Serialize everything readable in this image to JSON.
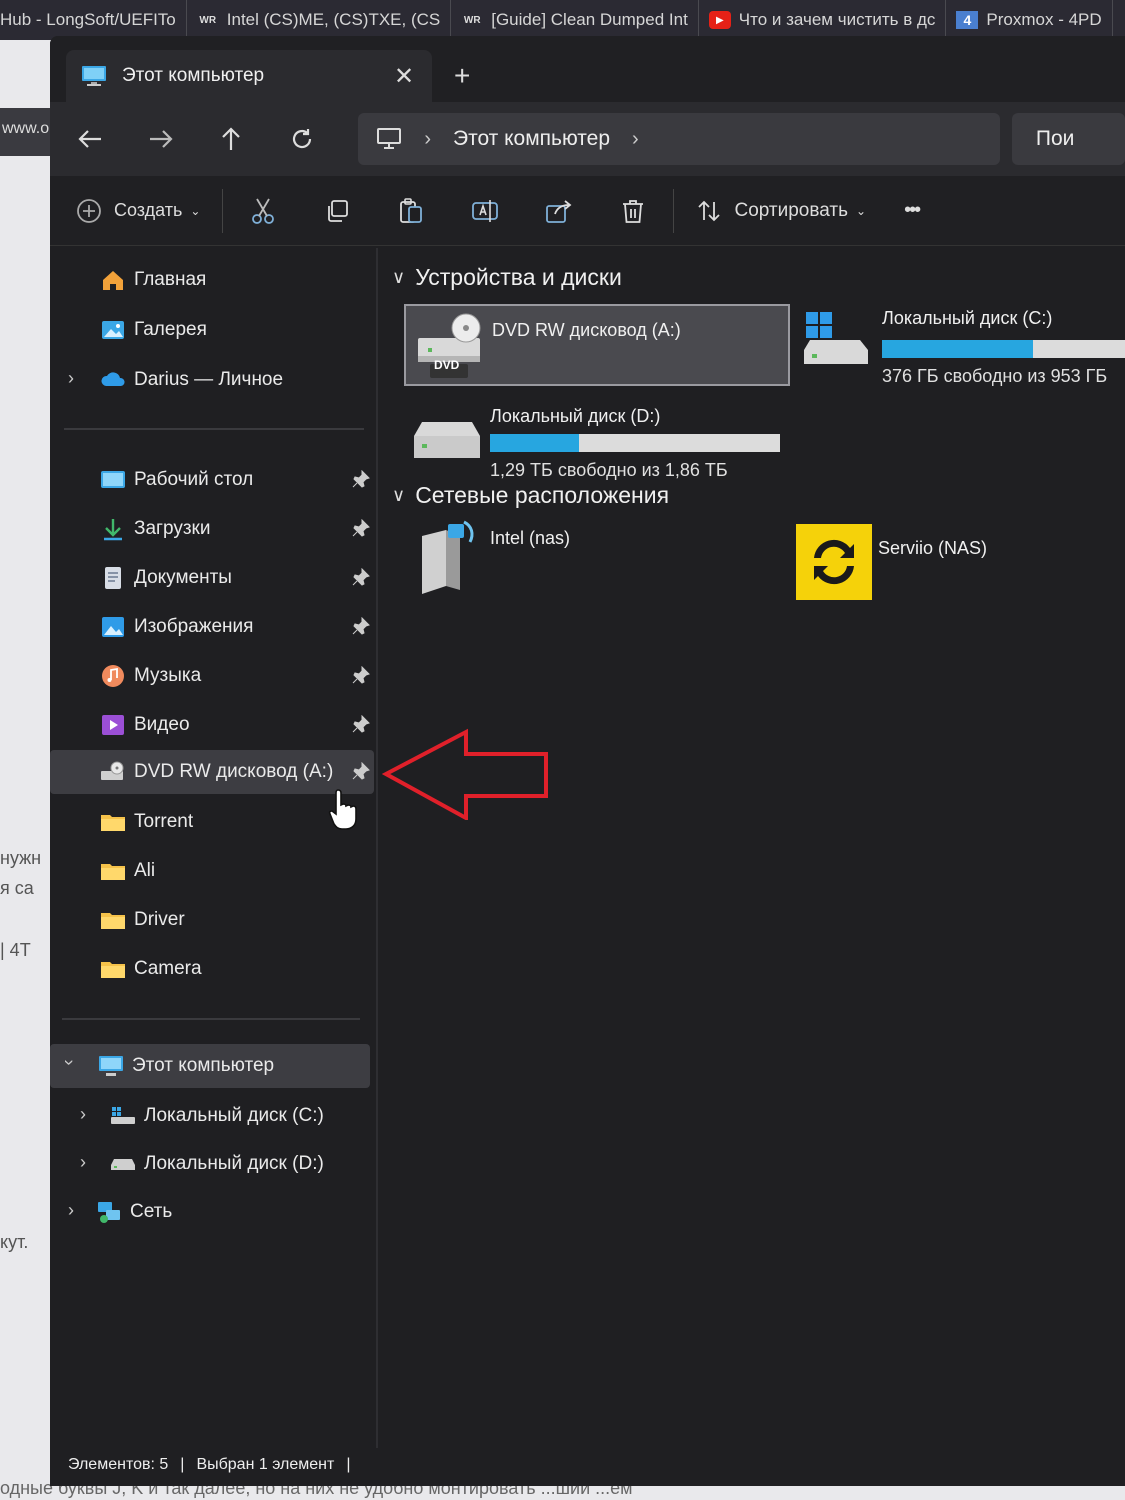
{
  "browser_tabs": [
    {
      "label": "Hub - LongSoft/UEFITo",
      "icon": "github-icon"
    },
    {
      "label": "Intel (CS)ME, (CS)TXE, (CS",
      "icon": "wr-icon",
      "fav": "WR"
    },
    {
      "label": "[Guide] Clean Dumped Int",
      "icon": "wr-icon",
      "fav": "WR"
    },
    {
      "label": "Что и зачем чистить в дс",
      "icon": "youtube-icon"
    },
    {
      "label": "Proxmox - 4PD",
      "icon": "proxmox-icon"
    }
  ],
  "bg_page": {
    "url_fragment": "www.o",
    "text_lines": [
      "нужн",
      "я са",
      "| 4Т",
      "кут."
    ],
    "bottom_text": "одные буквы J, K и так далее, но на них не удобно монтировать ...ший ...ем"
  },
  "window": {
    "tab_title": "Этот компьютер",
    "tab_close": "✕",
    "tab_new": "+"
  },
  "address": {
    "crumb": "Этот компьютер",
    "search_placeholder": "Пои"
  },
  "toolbar": {
    "create_label": "Создать",
    "sort_label": "Сортировать",
    "more_label": "•••"
  },
  "sidebar": {
    "home": "Главная",
    "gallery": "Галерея",
    "onedrive": "Darius — Личное",
    "pinned": [
      {
        "label": "Рабочий стол",
        "icon": "desktop-icon"
      },
      {
        "label": "Загрузки",
        "icon": "download-icon"
      },
      {
        "label": "Документы",
        "icon": "documents-icon"
      },
      {
        "label": "Изображения",
        "icon": "pictures-icon"
      },
      {
        "label": "Музыка",
        "icon": "music-icon"
      },
      {
        "label": "Видео",
        "icon": "video-icon"
      },
      {
        "label": "DVD RW дисковод (A:)",
        "icon": "dvd-drive-icon"
      }
    ],
    "folders": [
      "Torrent",
      "Ali",
      "Driver",
      "Camera"
    ],
    "this_pc": "Этот компьютер",
    "disk_c": "Локальный диск (C:)",
    "disk_d": "Локальный диск (D:)",
    "network": "Сеть"
  },
  "content": {
    "devices_header": "Устройства и диски",
    "dvd_name": "DVD RW дисковод (A:)",
    "dvd_badge": "DVD",
    "disk_c_name": "Локальный диск (C:)",
    "disk_c_free": "376 ГБ свободно из 953 ГБ",
    "disk_c_used_fraction": 0.605,
    "disk_d_name": "Локальный диск (D:)",
    "disk_d_free": "1,29 ТБ свободно из 1,86 ТБ",
    "disk_d_used_fraction": 0.306,
    "network_header": "Сетевые расположения",
    "net1": "Intel (nas)",
    "net2": "Serviio (NAS)"
  },
  "status": {
    "items": "Элементов: 5",
    "sep": "|",
    "selected": "Выбран 1 элемент",
    "sep2": "|"
  },
  "colors": {
    "accent": "#27a6e0",
    "arrow": "#e0202a",
    "serviio_yellow": "#f5d20a"
  }
}
